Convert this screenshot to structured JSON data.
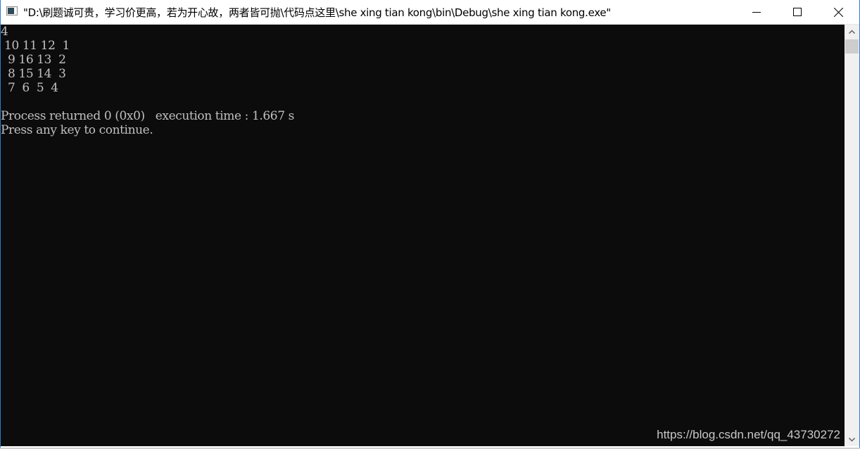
{
  "window": {
    "title": "\"D:\\刷题诚可贵，学习价更高，若为开心故，两者皆可抛\\代码点这里\\she xing tian kong\\bin\\Debug\\she xing tian kong.exe\"",
    "icon": "console-app-icon",
    "controls": {
      "minimize": "minimize-icon",
      "maximize": "maximize-icon",
      "close": "close-icon"
    }
  },
  "console": {
    "lines": [
      "4",
      " 10 11 12  1",
      "  9 16 13  2",
      "  8 15 14  3",
      "  7  6  5  4",
      "",
      "Process returned 0 (0x0)   execution time : 1.667 s",
      "Press any key to continue."
    ]
  },
  "watermark": "https://blog.csdn.net/qq_43730272",
  "colors": {
    "console_bg": "#0c0c0c",
    "console_fg": "#c0c0c0",
    "window_border": "#2b7cd3"
  }
}
